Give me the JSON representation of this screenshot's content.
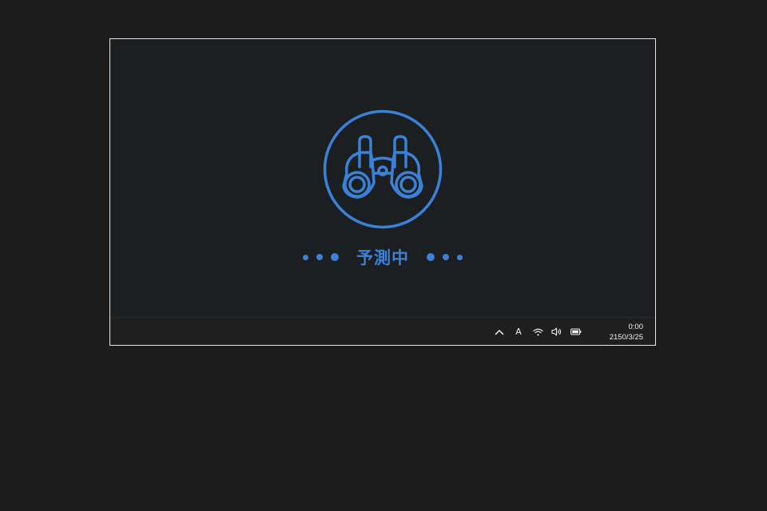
{
  "theme": {
    "accent": "#3b82d6",
    "background": "#1b1f22",
    "taskbar": "#1f1f1f"
  },
  "main": {
    "icon": "binoculars-icon",
    "status_text": "予測中"
  },
  "taskbar": {
    "tray": {
      "chevron_icon": "chevron-up-icon",
      "ime_label": "A",
      "wifi_icon": "wifi-icon",
      "volume_icon": "speaker-icon",
      "battery_icon": "battery-icon"
    },
    "clock": {
      "time": "0:00",
      "date": "2150/3/25"
    }
  }
}
